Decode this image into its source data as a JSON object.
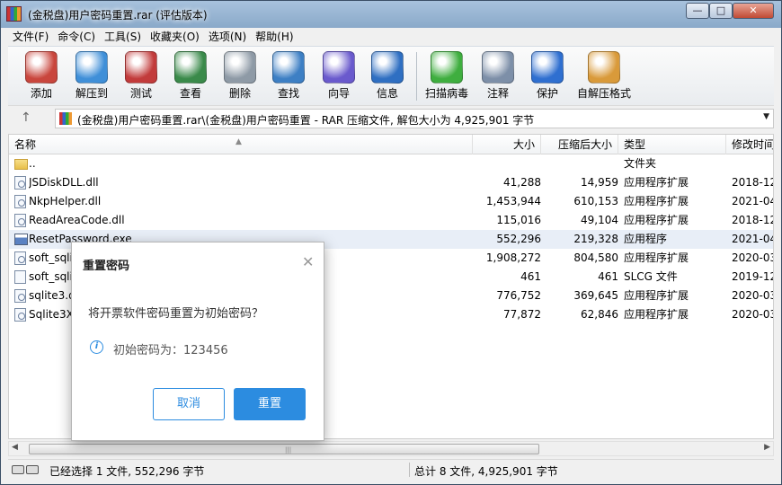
{
  "window": {
    "title": "(金税盘)用户密码重置.rar (评估版本)",
    "controls": {
      "minimize": "—",
      "maximize": "□",
      "close": "✕"
    }
  },
  "menu": [
    "文件(F)",
    "命令(C)",
    "工具(S)",
    "收藏夹(O)",
    "选项(N)",
    "帮助(H)"
  ],
  "toolbar": [
    {
      "label": "添加",
      "icon": "add-archive-icon",
      "color": "#c9463d"
    },
    {
      "label": "解压到",
      "icon": "extract-folder-icon",
      "color": "#3f8fd8"
    },
    {
      "label": "测试",
      "icon": "test-clipboard-icon",
      "color": "#c23b3b"
    },
    {
      "label": "查看",
      "icon": "view-book-icon",
      "color": "#3a8a4a"
    },
    {
      "label": "删除",
      "icon": "delete-trash-icon",
      "color": "#8e9aa6"
    },
    {
      "label": "查找",
      "icon": "find-magnifier-icon",
      "color": "#3d7fc4"
    },
    {
      "label": "向导",
      "icon": "wizard-wand-icon",
      "color": "#6a5acd"
    },
    {
      "label": "信息",
      "icon": "info-icon",
      "color": "#2f6fc2"
    },
    {
      "label": "扫描病毒",
      "icon": "virus-scan-icon",
      "color": "#3fae3f"
    },
    {
      "label": "注释",
      "icon": "comment-icon",
      "color": "#7d8fa8"
    },
    {
      "label": "保护",
      "icon": "protect-shield-icon",
      "color": "#2f6fd0"
    },
    {
      "label": "自解压格式",
      "icon": "sfx-box-icon",
      "color": "#d99a3a"
    }
  ],
  "address": {
    "up": "↑",
    "path": "(金税盘)用户密码重置.rar\\(金税盘)用户密码重置 - RAR 压缩文件, 解包大小为 4,925,901 字节",
    "dropdown": "▼"
  },
  "columns": {
    "name": "名称",
    "size": "大小",
    "packed": "压缩后大小",
    "type": "类型",
    "modified": "修改时间",
    "sort": "▲"
  },
  "files": [
    {
      "name": "..",
      "size": "",
      "packed": "",
      "type": "文件夹",
      "modified": "",
      "kind": "folder"
    },
    {
      "name": "JSDiskDLL.dll",
      "size": "41,288",
      "packed": "14,959",
      "type": "应用程序扩展",
      "modified": "2018-12",
      "kind": "dll"
    },
    {
      "name": "NkpHelper.dll",
      "size": "1,453,944",
      "packed": "610,153",
      "type": "应用程序扩展",
      "modified": "2021-04",
      "kind": "dll"
    },
    {
      "name": "ReadAreaCode.dll",
      "size": "115,016",
      "packed": "49,104",
      "type": "应用程序扩展",
      "modified": "2018-12",
      "kind": "dll"
    },
    {
      "name": "ResetPassword.exe",
      "size": "552,296",
      "packed": "219,328",
      "type": "应用程序",
      "modified": "2021-04",
      "kind": "exe",
      "selected": true
    },
    {
      "name": "soft_sqlite.dll",
      "size": "1,908,272",
      "packed": "804,580",
      "type": "应用程序扩展",
      "modified": "2020-03",
      "kind": "dll"
    },
    {
      "name": "soft_sqlite.slcg",
      "size": "461",
      "packed": "461",
      "type": "SLCG 文件",
      "modified": "2019-12",
      "kind": "file"
    },
    {
      "name": "sqlite3.dll",
      "size": "776,752",
      "packed": "369,645",
      "type": "应用程序扩展",
      "modified": "2020-03",
      "kind": "dll"
    },
    {
      "name": "Sqlite3X.dll",
      "size": "77,872",
      "packed": "62,846",
      "type": "应用程序扩展",
      "modified": "2020-03",
      "kind": "dll"
    }
  ],
  "scrollbar": {
    "left": "◀",
    "right": "▶",
    "grip": "|||"
  },
  "status": {
    "left": "已经选择 1 文件, 552,296 字节",
    "right": "总计 8 文件, 4,925,901 字节"
  },
  "dialog": {
    "title": "重置密码",
    "close": "✕",
    "question": "将开票软件密码重置为初始密码？",
    "info_icon": "i",
    "info": "初始密码为：123456",
    "cancel": "取消",
    "confirm": "重置",
    "accent": "#2c8ce0"
  }
}
